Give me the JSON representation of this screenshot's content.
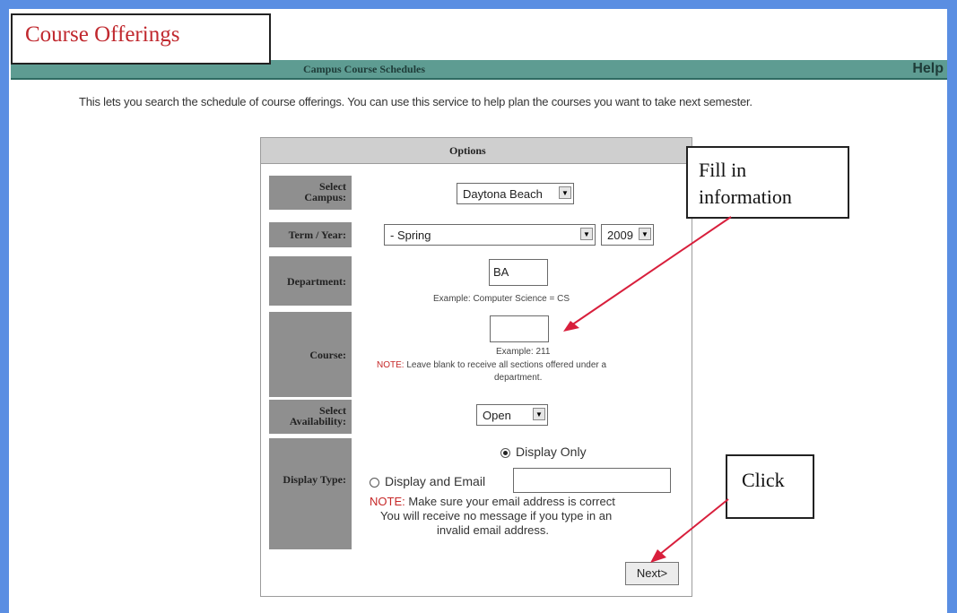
{
  "page": {
    "title": "Course Offerings",
    "header_title": "Campus Course Schedules",
    "help": "Help",
    "intro": "This lets you search the schedule of course offerings. You can use this service to help plan the courses you want to take next semester."
  },
  "options": {
    "title": "Options",
    "campus": {
      "label_1": "Select",
      "label_2": "Campus:",
      "value": "Daytona Beach"
    },
    "term_year": {
      "label": "Term / Year:",
      "term_value": "- Spring",
      "year_value": "2009"
    },
    "department": {
      "label": "Department:",
      "value": "BA",
      "example": "Example: Computer Science = CS"
    },
    "course": {
      "label": "Course:",
      "value": "",
      "example": "Example: 211",
      "note_label": "NOTE:",
      "note_1": "Leave blank to receive all sections offered under a",
      "note_2": "department."
    },
    "availability": {
      "label_1": "Select",
      "label_2": "Availability:",
      "value": "Open"
    },
    "display_type": {
      "label": "Display Type:",
      "option_only": "Display Only",
      "option_email": "Display and Email",
      "email_value": "",
      "note_label": "NOTE:",
      "note_1": "Make sure your email address is correct",
      "note_2": "You will receive no message if you type in an",
      "note_3": "invalid email address."
    },
    "next_button": "Next>"
  },
  "callouts": {
    "fill_1": "Fill in",
    "fill_2": "information",
    "click": "Click"
  },
  "colors": {
    "background": "#5a8ee2",
    "header_bar": "#5e9c92",
    "label_cell": "#8f8f8f",
    "title_red": "#c0282e",
    "arrow": "#d81f3c"
  }
}
